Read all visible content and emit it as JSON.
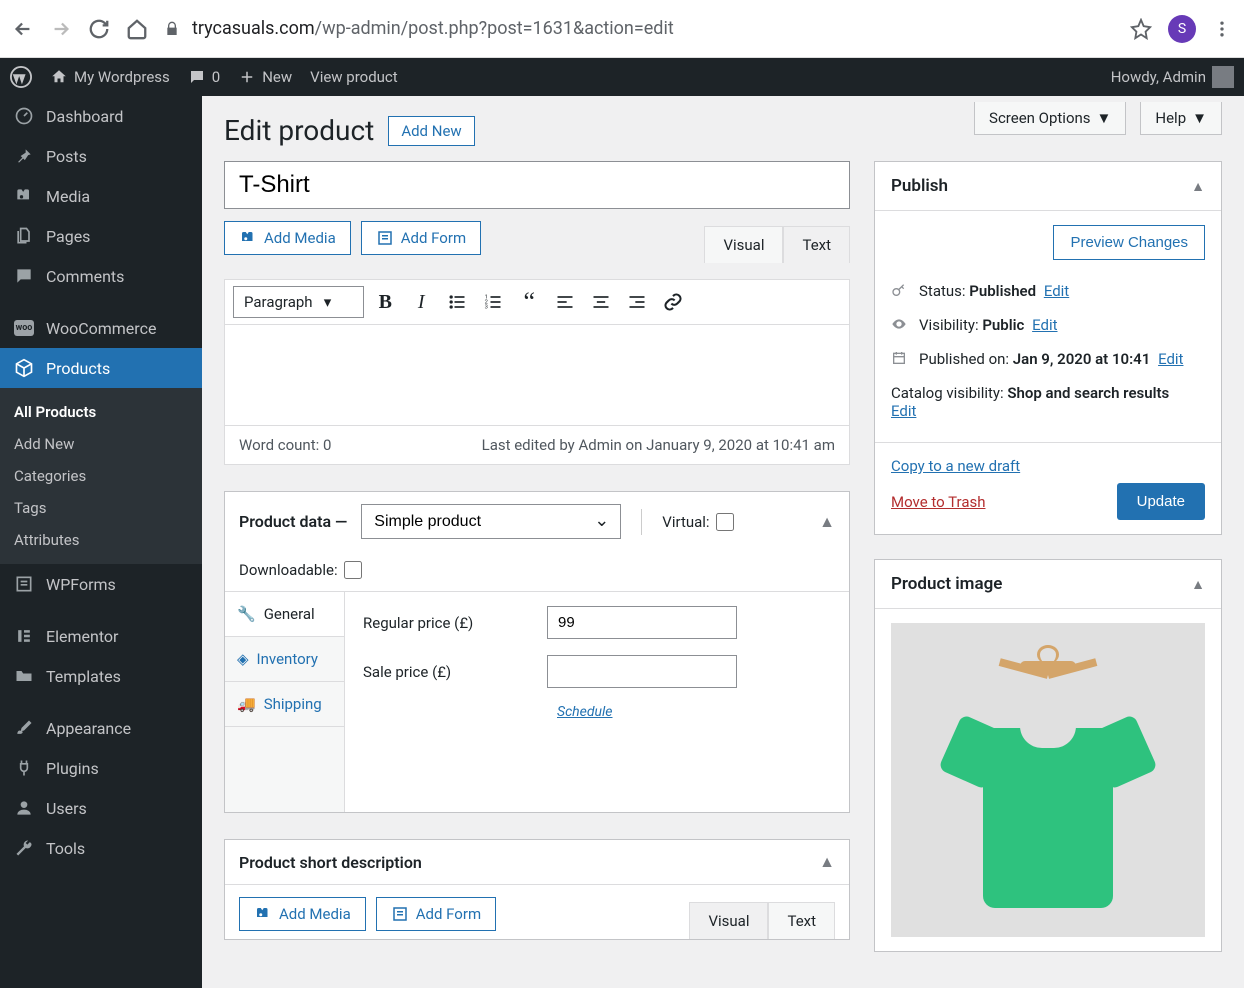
{
  "browser": {
    "url_domain": "trycasuals.com",
    "url_path": "/wp-admin/post.php?post=1631&action=edit",
    "avatar_letter": "S"
  },
  "adminbar": {
    "site_name": "My Wordpress",
    "comments_count": "0",
    "new_label": "New",
    "view_label": "View product",
    "howdy": "Howdy, Admin"
  },
  "sidebar": {
    "items": [
      {
        "label": "Dashboard"
      },
      {
        "label": "Posts"
      },
      {
        "label": "Media"
      },
      {
        "label": "Pages"
      },
      {
        "label": "Comments"
      },
      {
        "label": "WooCommerce"
      },
      {
        "label": "Products"
      },
      {
        "label": "WPForms"
      },
      {
        "label": "Elementor"
      },
      {
        "label": "Templates"
      },
      {
        "label": "Appearance"
      },
      {
        "label": "Plugins"
      },
      {
        "label": "Users"
      },
      {
        "label": "Tools"
      }
    ],
    "submenu": [
      {
        "label": "All Products",
        "current": true
      },
      {
        "label": "Add New"
      },
      {
        "label": "Categories"
      },
      {
        "label": "Tags"
      },
      {
        "label": "Attributes"
      }
    ]
  },
  "top_tabs": {
    "screen_options": "Screen Options",
    "help": "Help"
  },
  "page": {
    "heading": "Edit product",
    "add_new": "Add New",
    "title_value": "T-Shirt"
  },
  "editor": {
    "add_media": "Add Media",
    "add_form": "Add Form",
    "visual_tab": "Visual",
    "text_tab": "Text",
    "format_select": "Paragraph",
    "word_count": "Word count: 0",
    "last_edit": "Last edited by Admin on January 9, 2020 at 10:41 am"
  },
  "product_data": {
    "title": "Product data —",
    "type_value": "Simple product",
    "virtual_label": "Virtual:",
    "downloadable_label": "Downloadable:",
    "tabs": {
      "general": "General",
      "inventory": "Inventory",
      "shipping": "Shipping"
    },
    "regular_price_label": "Regular price (£)",
    "regular_price_value": "99",
    "sale_price_label": "Sale price (£)",
    "sale_price_value": "",
    "schedule_label": "Schedule"
  },
  "short_desc": {
    "title": "Product short description",
    "add_media": "Add Media",
    "add_form": "Add Form",
    "visual_tab": "Visual",
    "text_tab": "Text"
  },
  "publish": {
    "title": "Publish",
    "preview_label": "Preview Changes",
    "status_label": "Status: ",
    "status_value": "Published",
    "visibility_label": "Visibility: ",
    "visibility_value": "Public",
    "published_label": "Published on: ",
    "published_value": "Jan 9, 2020 at 10:41",
    "catalog_label": "Catalog visibility: ",
    "catalog_value": "Shop and search results",
    "edit_label": "Edit",
    "copy_label": "Copy to a new draft",
    "trash_label": "Move to Trash",
    "update_label": "Update"
  },
  "product_image": {
    "title": "Product image"
  }
}
